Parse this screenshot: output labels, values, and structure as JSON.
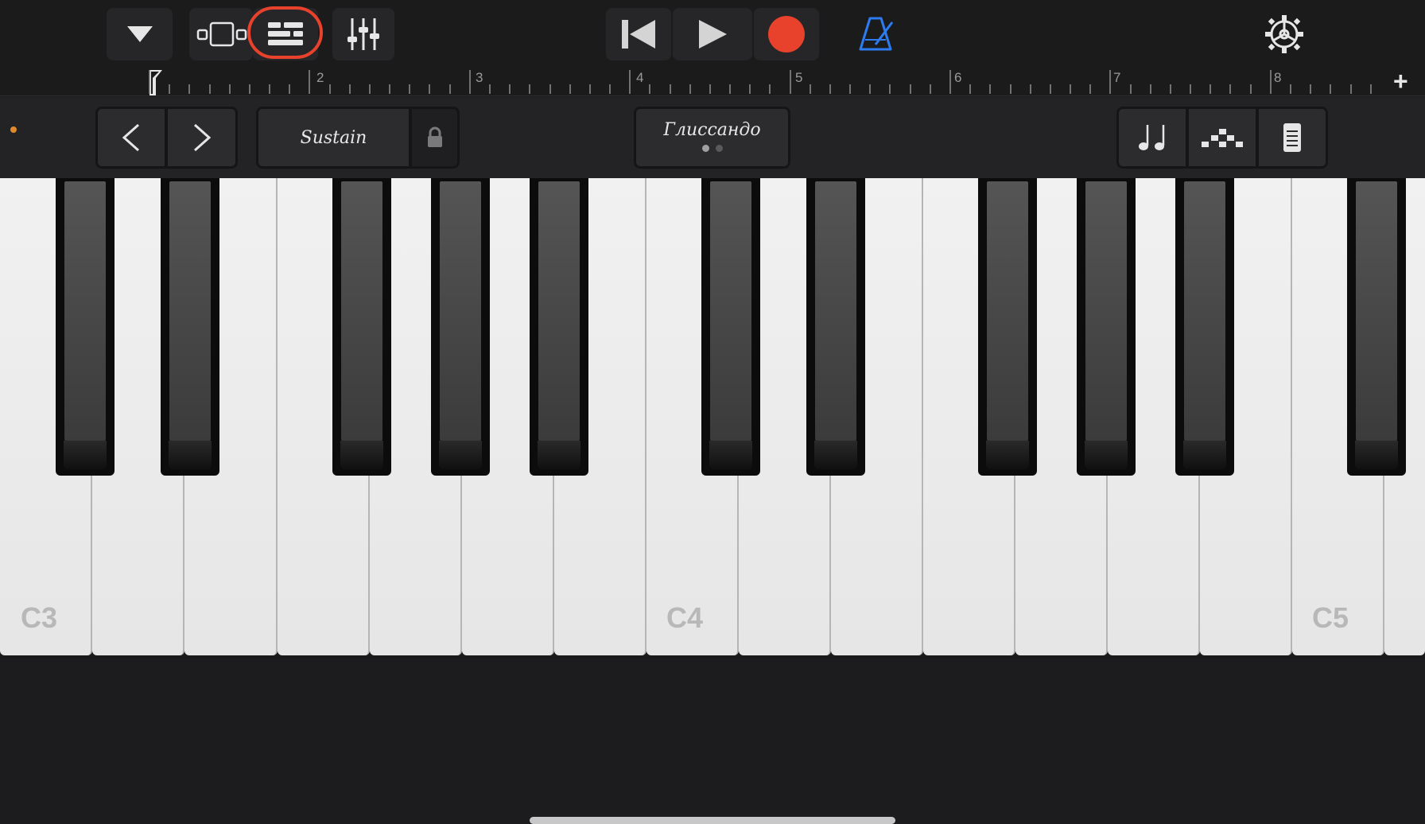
{
  "toolbar": {
    "buttons": [
      "browser-dropdown",
      "view-toggle",
      "tracks-view",
      "mixer",
      "go-to-beginning",
      "play",
      "record",
      "metronome",
      "settings"
    ],
    "record_color": "#e8412c",
    "metronome_color": "#2d7bf0",
    "highlight_color": "#e8412c"
  },
  "ruler": {
    "bars": [
      "2",
      "3",
      "4",
      "5",
      "6",
      "7",
      "8"
    ],
    "add_label": "+"
  },
  "controls": {
    "sustain_label": "Sustain",
    "glissando_label": "Глиссандо",
    "activity_dot_color": "#e08a2c"
  },
  "keyboard": {
    "octave_labels": [
      "C3",
      "C4",
      "C5"
    ]
  }
}
